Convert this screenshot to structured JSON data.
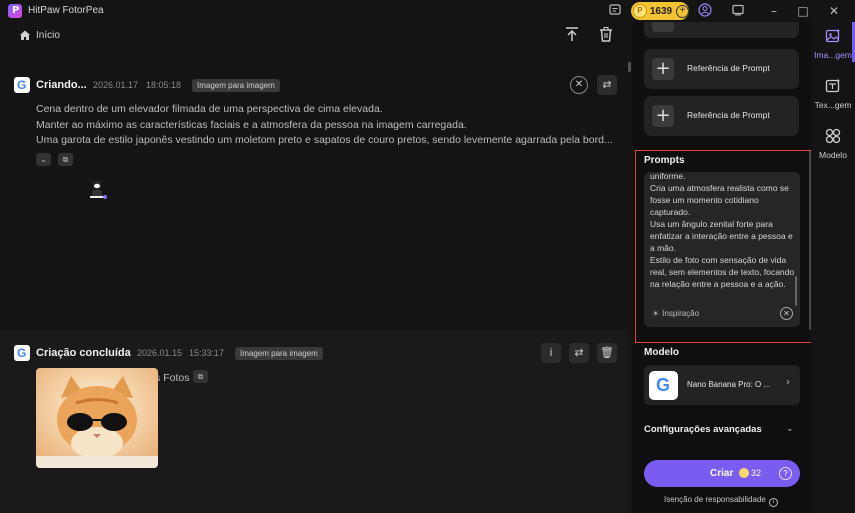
{
  "window": {
    "title": "HitPaw FotorPea",
    "logo_letter": "P",
    "credits": "1639"
  },
  "toolbar": {
    "home_label": "Início"
  },
  "feed": {
    "cards": [
      {
        "title": "Criando...",
        "date": "2026.01.17",
        "time": "18:05:18",
        "badge": "Imagem para imagem",
        "prompt_lines": [
          "Cena dentro de um elevador filmada de uma perspectiva de cima elevada.",
          "Manter ao máximo as características faciais e a atmosfera da pessoa na imagem carregada.",
          "Uma garota de estilo japonês vestindo um moletom preto e sapatos de couro pretos, sendo levemente agarrada pela bord..."
        ]
      },
      {
        "title": "Criação concluída",
        "date": "2026.01.15",
        "time": "15:33:17",
        "badge": "Imagem para imagem",
        "prompt_lines": [
          "Colocar Óculos de Sol nas Fotos"
        ]
      }
    ]
  },
  "panel": {
    "reference_cards": [
      {
        "label": "Referência de Prompt"
      },
      {
        "label": "Referência de Prompt"
      }
    ],
    "prompts": {
      "title": "Prompts",
      "text": "uniforme.\nCria uma atmosfera realista como se fosse um momento cotidiano capturado.\nUsa um ângulo zenital forte para enfatizar a interação entre a pessoa e a mão.\nEstilo de foto com sensação de vida real, sem elementos de texto, focando na relação entre a pessoa e a ação.",
      "inspiration_label": "Inspiração"
    },
    "model": {
      "title": "Modelo",
      "name": "Nano Banana Pro: O ..."
    },
    "advanced_label": "Configurações avançadas",
    "create": {
      "label": "Criar",
      "cost": "32"
    },
    "disclaimer": "Isenção de responsabilidade"
  },
  "rail": {
    "items": [
      {
        "label": "Ima...gem",
        "active": true
      },
      {
        "label": "Tex...gem",
        "active": false
      },
      {
        "label": "Modelo",
        "active": false
      }
    ]
  },
  "colors": {
    "accent": "#7b5cf0",
    "highlight_border": "#e0463c",
    "credits_badge": "#f1c232"
  }
}
